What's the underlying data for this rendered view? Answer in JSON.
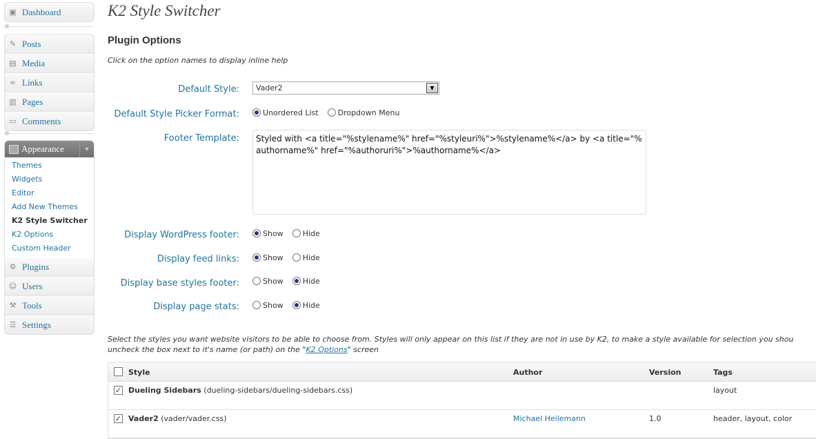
{
  "sidebar": {
    "dashboard": {
      "label": "Dashboard",
      "icon": "dashboard-icon"
    },
    "content_items": [
      {
        "label": "Posts",
        "icon": "pushpin-icon"
      },
      {
        "label": "Media",
        "icon": "media-icon"
      },
      {
        "label": "Links",
        "icon": "link-icon"
      },
      {
        "label": "Pages",
        "icon": "pages-icon"
      },
      {
        "label": "Comments",
        "icon": "comment-icon"
      }
    ],
    "appearance": {
      "label": "Appearance",
      "submenu": [
        {
          "label": "Themes"
        },
        {
          "label": "Widgets"
        },
        {
          "label": "Editor"
        },
        {
          "label": "Add New Themes"
        },
        {
          "label": "K2 Style Switcher",
          "current": true
        },
        {
          "label": "K2 Options"
        },
        {
          "label": "Custom Header"
        }
      ]
    },
    "tool_items": [
      {
        "label": "Plugins",
        "icon": "plugin-icon"
      },
      {
        "label": "Users",
        "icon": "users-icon"
      },
      {
        "label": "Tools",
        "icon": "tools-icon"
      },
      {
        "label": "Settings",
        "icon": "settings-icon"
      }
    ]
  },
  "main": {
    "title": "K2 Style Switcher",
    "section_title": "Plugin Options",
    "help_text": "Click on the option names to display inline help",
    "options": {
      "default_style": {
        "label": "Default Style:",
        "value": "Vader2"
      },
      "picker_format": {
        "label": "Default Style Picker Format:",
        "opt1": "Unordered List",
        "opt2": "Dropdown Menu",
        "selected": "Unordered List"
      },
      "footer_template": {
        "label": "Footer Template:",
        "value": "Styled with <a title=\"%stylename%\" href=\"%styleuri%\">%stylename%</a> by <a title=\"%authorname%\" href=\"%authoruri%\">%authorname%</a>"
      },
      "wp_footer": {
        "label": "Display WordPress footer:",
        "opt1": "Show",
        "opt2": "Hide",
        "selected": "Show"
      },
      "feed_links": {
        "label": "Display feed links:",
        "opt1": "Show",
        "opt2": "Hide",
        "selected": "Show"
      },
      "base_footer": {
        "label": "Display base styles footer:",
        "opt1": "Show",
        "opt2": "Hide",
        "selected": "Hide"
      },
      "page_stats": {
        "label": "Display page stats:",
        "opt1": "Show",
        "opt2": "Hide",
        "selected": "Hide"
      }
    },
    "styles_desc": {
      "line1": "Select the styles you want website visitors to be able to choose from. Styles will only appear on this list if they are not in use by K2, to make a style available for selection you shou",
      "line2_prefix": "uncheck the box next to it's name (or path) on the \"",
      "link": "K2 Options",
      "line2_suffix": "\" screen"
    },
    "table": {
      "headers": {
        "style": "Style",
        "author": "Author",
        "version": "Version",
        "tags": "Tags"
      },
      "rows": [
        {
          "checked": true,
          "name": "Dueling Sidebars",
          "path": "(dueling-sidebars/dueling-sidebars.css)",
          "author": "",
          "version": "",
          "tags": "layout"
        },
        {
          "checked": true,
          "name": "Vader2",
          "path": "(vader/vader.css)",
          "author": "Michael Heilemann",
          "version": "1.0",
          "tags": "header, layout, color"
        }
      ]
    }
  }
}
